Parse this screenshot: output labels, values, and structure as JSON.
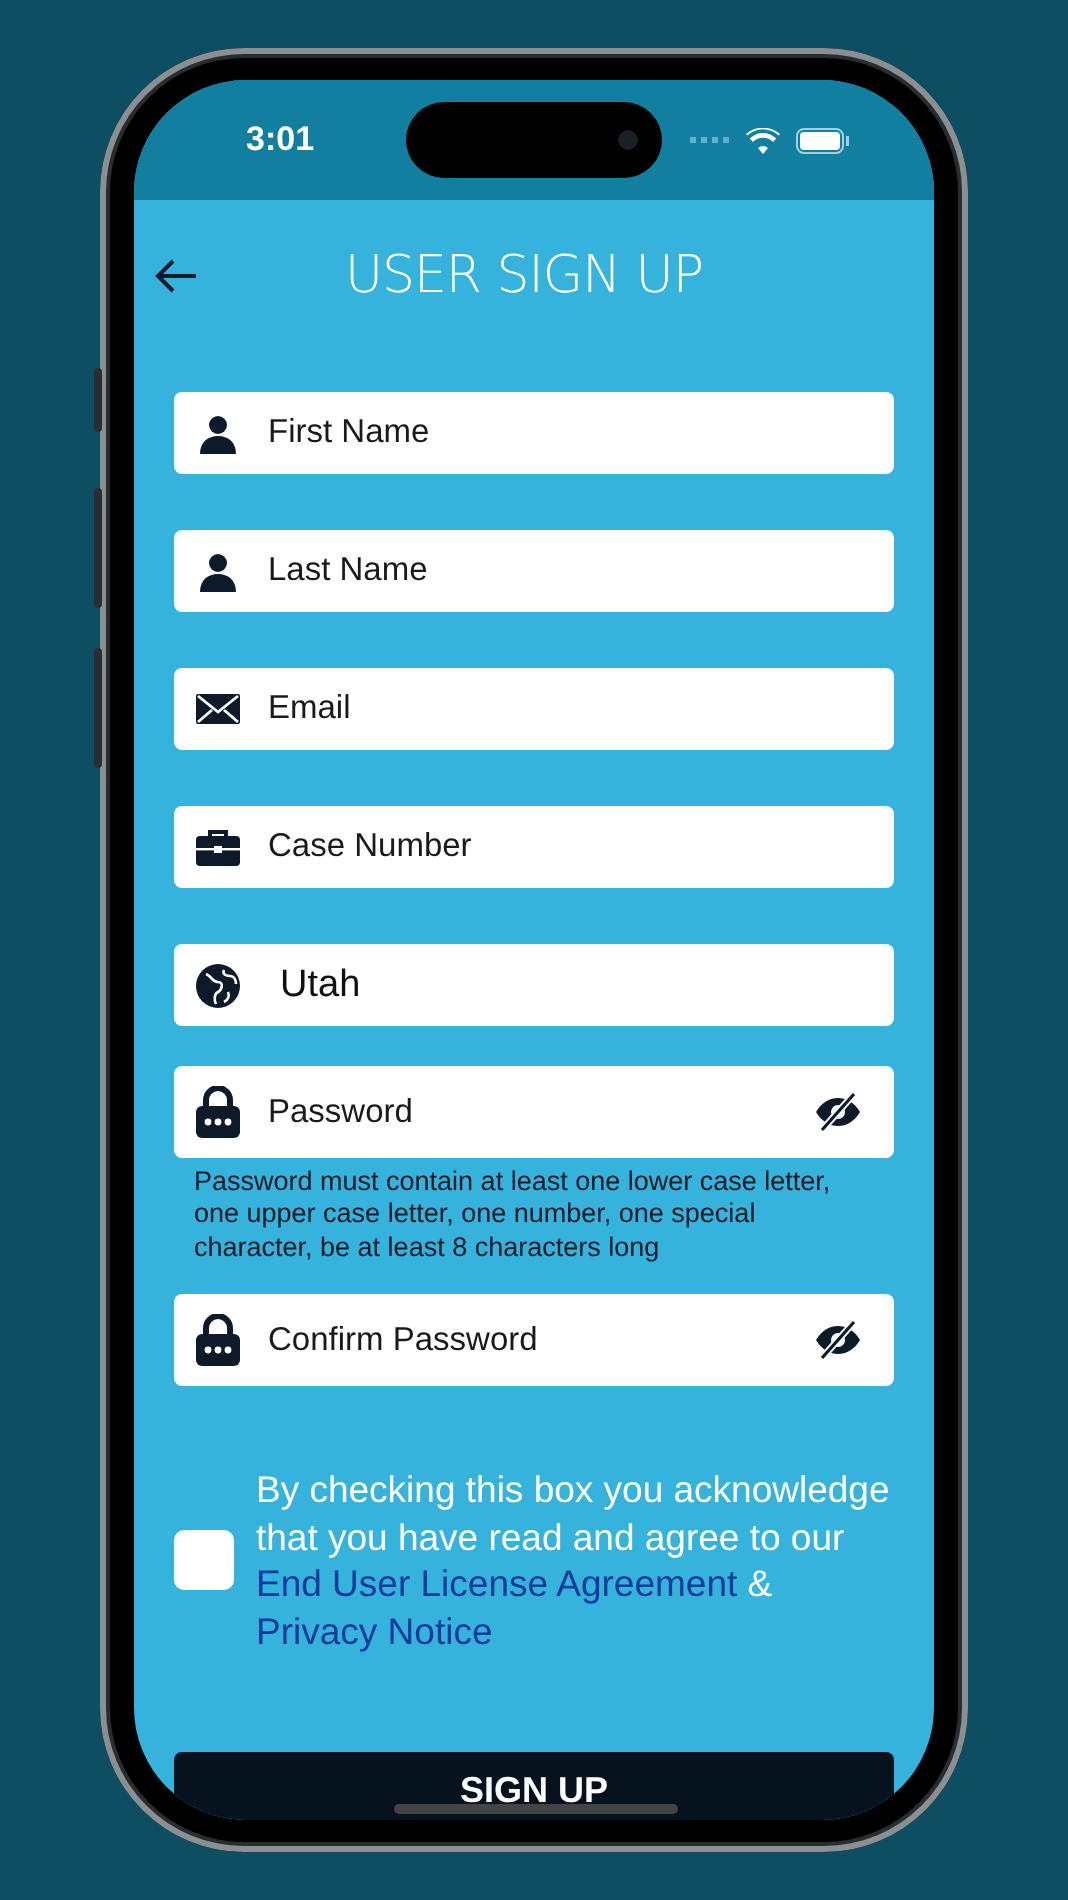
{
  "status_bar": {
    "time": "3:01"
  },
  "header": {
    "title": "USER SIGN UP"
  },
  "fields": [
    {
      "kind": "person",
      "placeholder": "First Name"
    },
    {
      "kind": "person",
      "placeholder": "Last Name"
    },
    {
      "kind": "email",
      "placeholder": "Email"
    },
    {
      "kind": "case",
      "placeholder": "Case Number"
    },
    {
      "kind": "globe",
      "value": "Utah"
    },
    {
      "kind": "lock",
      "placeholder": "Password",
      "password_visible": false,
      "hint": "Password must contain at least one lower case letter, one upper case letter, one number, one special character, be at least 8 characters long"
    },
    {
      "kind": "lock",
      "placeholder": "Confirm Password",
      "password_visible": false
    }
  ],
  "agreement": {
    "checked": false,
    "text": "By checking this box you acknowledge that you have read and agree to our",
    "links": [
      "End User License Agreement",
      "Privacy Notice"
    ],
    "separator": "&"
  },
  "submit": {
    "label": "SIGN UP"
  }
}
